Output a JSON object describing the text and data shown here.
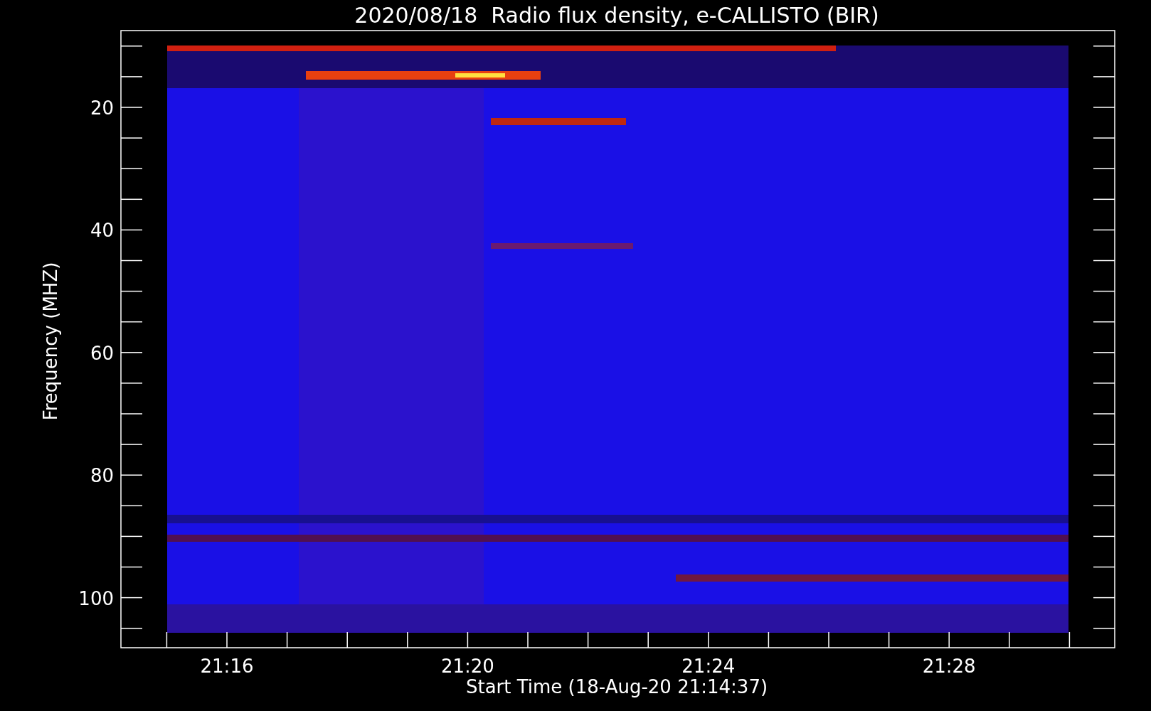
{
  "title": "2020/08/18  Radio flux density, e-CALLISTO (BIR)",
  "y_axis": {
    "label": "Frequency (MHZ)",
    "ticks": [
      "20",
      "40",
      "60",
      "80",
      "100"
    ]
  },
  "x_axis": {
    "label": "Start Time (18-Aug-20 21:14:37)",
    "ticks": [
      "21:16",
      "21:20",
      "21:24",
      "21:28"
    ]
  }
}
